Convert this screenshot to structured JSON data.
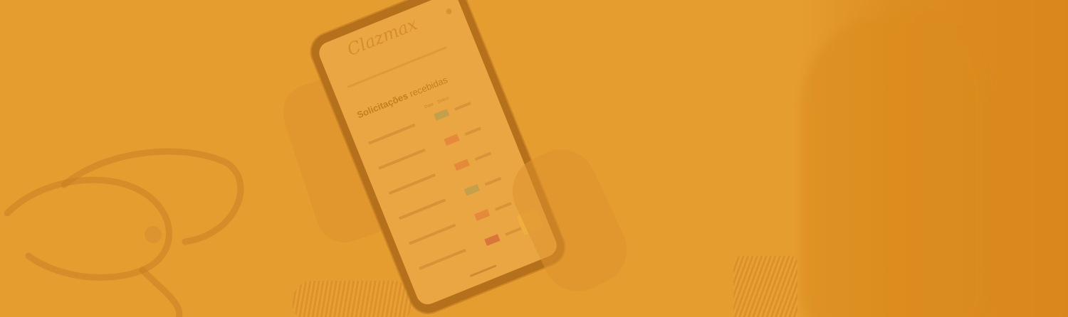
{
  "image": {
    "description_overlay_color": "#e69d2f"
  },
  "phone_app": {
    "logo": "Clazmax",
    "heading_bold": "Solicitações",
    "heading_rest": "recebidas",
    "column_labels": [
      "Data",
      "Status"
    ],
    "rows": [
      {
        "chip_color": "#c3a04a"
      },
      {
        "chip_color": "#e58a3a"
      },
      {
        "chip_color": "#e58a3a"
      },
      {
        "chip_color": "#c3a04a"
      },
      {
        "chip_color": "#e58a3a"
      },
      {
        "chip_color": "#d9763a"
      }
    ]
  }
}
